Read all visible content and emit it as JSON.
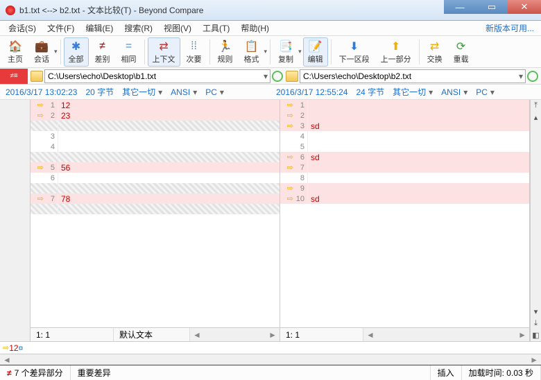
{
  "title": "b1.txt <--> b2.txt - 文本比较(T) - Beyond Compare",
  "menu": {
    "session": "会话(S)",
    "file": "文件(F)",
    "edit": "编辑(E)",
    "search": "搜索(R)",
    "view": "视图(V)",
    "tools": "工具(T)",
    "help": "帮助(H)"
  },
  "newversion": "新版本可用...",
  "toolbar": {
    "home": "主页",
    "session": "会话",
    "all": "全部",
    "diff": "差别",
    "same": "相同",
    "context": "上下文",
    "minor": "次要",
    "rules": "规则",
    "format": "格式",
    "copy": "复制",
    "edit": "编辑",
    "nextsec": "下一区段",
    "prevpart": "上一部分",
    "swap": "交换",
    "reload": "重载"
  },
  "left": {
    "path": "C:\\Users\\echo\\Desktop\\b1.txt",
    "time": "2016/3/17 13:02:23",
    "size": "20 字节",
    "other": "其它一切",
    "enc": "ANSI",
    "platform": "PC",
    "lines": [
      {
        "n": "1",
        "arr": true,
        "cls": "bg-diff",
        "t": "12"
      },
      {
        "n": "2",
        "arr": true,
        "cls": "bg-diff",
        "t": "23"
      },
      {
        "n": "",
        "arr": false,
        "cls": "bg-miss",
        "t": ""
      },
      {
        "n": "3",
        "arr": false,
        "cls": "",
        "t": ""
      },
      {
        "n": "4",
        "arr": false,
        "cls": "",
        "t": ""
      },
      {
        "n": "",
        "arr": false,
        "cls": "bg-miss",
        "t": ""
      },
      {
        "n": "5",
        "arr": true,
        "cls": "bg-diff",
        "t": "56"
      },
      {
        "n": "6",
        "arr": false,
        "cls": "",
        "t": ""
      },
      {
        "n": "",
        "arr": false,
        "cls": "bg-miss",
        "t": ""
      },
      {
        "n": "7",
        "arr": true,
        "cls": "bg-diff",
        "t": "78"
      },
      {
        "n": "",
        "arr": false,
        "cls": "bg-miss",
        "t": ""
      }
    ],
    "pos": "1: 1",
    "mode": "默认文本"
  },
  "right": {
    "path": "C:\\Users\\echo\\Desktop\\b2.txt",
    "time": "2016/3/17 12:55:24",
    "size": "24 字节",
    "other": "其它一切",
    "enc": "ANSI",
    "platform": "PC",
    "lines": [
      {
        "n": "1",
        "arr": true,
        "cls": "bg-diff",
        "t": ""
      },
      {
        "n": "2",
        "arr": true,
        "cls": "bg-diff",
        "t": ""
      },
      {
        "n": "3",
        "arr": true,
        "cls": "bg-diff",
        "t": "sd"
      },
      {
        "n": "4",
        "arr": false,
        "cls": "",
        "t": ""
      },
      {
        "n": "5",
        "arr": false,
        "cls": "",
        "t": ""
      },
      {
        "n": "6",
        "arr": true,
        "cls": "bg-diff",
        "t": "sd"
      },
      {
        "n": "7",
        "arr": true,
        "cls": "bg-diff",
        "t": ""
      },
      {
        "n": "8",
        "arr": false,
        "cls": "",
        "t": ""
      },
      {
        "n": "9",
        "arr": true,
        "cls": "bg-diff",
        "t": ""
      },
      {
        "n": "10",
        "arr": true,
        "cls": "bg-diff",
        "t": "sd"
      }
    ],
    "pos": "1: 1"
  },
  "preview": {
    "t": "12",
    "m": "¤"
  },
  "status": {
    "diffcount": "7 个差异部分",
    "important": "重要差异",
    "insert": "插入",
    "loadtime": "加载时间: 0.03 秒"
  }
}
